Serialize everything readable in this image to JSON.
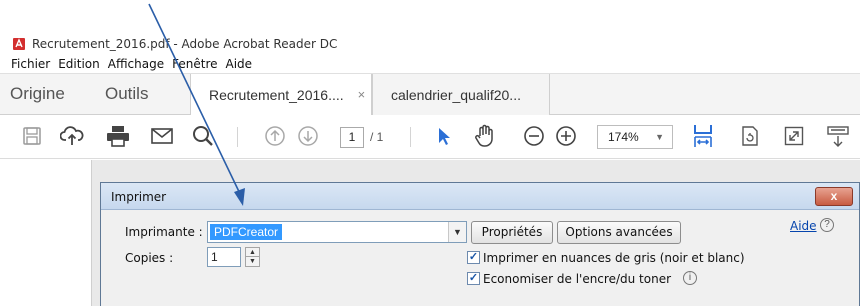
{
  "window": {
    "title": "Recrutement_2016.pdf - Adobe Acrobat Reader DC"
  },
  "menu": {
    "items": [
      "Fichier",
      "Edition",
      "Affichage",
      "Fenêtre",
      "Aide"
    ]
  },
  "tabs": {
    "home": "Origine",
    "tools": "Outils",
    "documents": [
      {
        "label": "Recrutement_2016....",
        "close": "×",
        "active": true
      },
      {
        "label": "calendrier_qualif20...",
        "active": false
      }
    ]
  },
  "toolbar": {
    "icons": [
      "save-icon",
      "upload-cloud-icon",
      "print-icon",
      "email-icon",
      "search-icon",
      "prev-page-icon",
      "next-page-icon",
      "select-cursor-icon",
      "hand-tool-icon",
      "zoom-out-icon",
      "zoom-in-icon",
      "fit-width-icon",
      "rotate-page-icon",
      "fullscreen-icon",
      "comment-icon"
    ],
    "page_current": "1",
    "page_total": "/ 1",
    "zoom": "174%"
  },
  "print_dialog": {
    "title": "Imprimer",
    "close_label": "x",
    "printer_label": "Imprimante :",
    "printer_value": "PDFCreator",
    "properties_button": "Propriétés",
    "advanced_button": "Options avancées",
    "help_link": "Aide",
    "copies_label": "Copies :",
    "copies_value": "1",
    "grayscale_label": "Imprimer en nuances de gris (noir et blanc)",
    "grayscale_checked": true,
    "save_ink_label": "Economiser de l'encre/du toner",
    "save_ink_checked": true
  },
  "colors": {
    "accent_blue": "#2b6fd6",
    "selection_blue": "#3399ff",
    "dialog_close_red": "#c75b41",
    "annotation_arrow": "#2b5ea8"
  }
}
